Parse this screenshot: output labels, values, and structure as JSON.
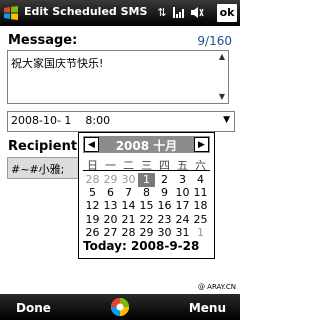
{
  "titlebar": {
    "title": "Edit Scheduled SMS",
    "ok_label": "ok",
    "icons": [
      "connectivity-icon",
      "signal-icon",
      "volume-icon"
    ]
  },
  "message": {
    "label": "Message:",
    "counter": "9/160",
    "text": "祝大家国庆节快乐!"
  },
  "datetime": {
    "value": "2008-10- 1    8:00"
  },
  "recipient": {
    "label": "Recipient(s):",
    "value": "#~#小雅;"
  },
  "calendar": {
    "month_title": "2008 十月",
    "weekdays": [
      "日",
      "一",
      "二",
      "三",
      "四",
      "五",
      "六"
    ],
    "weeks": [
      [
        "28",
        "29",
        "30",
        "1",
        "2",
        "3",
        "4"
      ],
      [
        "5",
        "6",
        "7",
        "8",
        "9",
        "10",
        "11"
      ],
      [
        "12",
        "13",
        "14",
        "15",
        "16",
        "17",
        "18"
      ],
      [
        "19",
        "20",
        "21",
        "22",
        "23",
        "24",
        "25"
      ],
      [
        "26",
        "27",
        "28",
        "29",
        "30",
        "31",
        "1"
      ]
    ],
    "muted": [
      [
        true,
        true,
        true,
        false,
        false,
        false,
        false
      ],
      [],
      [],
      [],
      [
        false,
        false,
        false,
        false,
        false,
        false,
        true
      ]
    ],
    "selected_day": "1",
    "today_label": "Today: 2008-9-28"
  },
  "softkeys": {
    "left": "Done",
    "right": "Menu"
  },
  "watermark": "@ ARAY.CN"
}
